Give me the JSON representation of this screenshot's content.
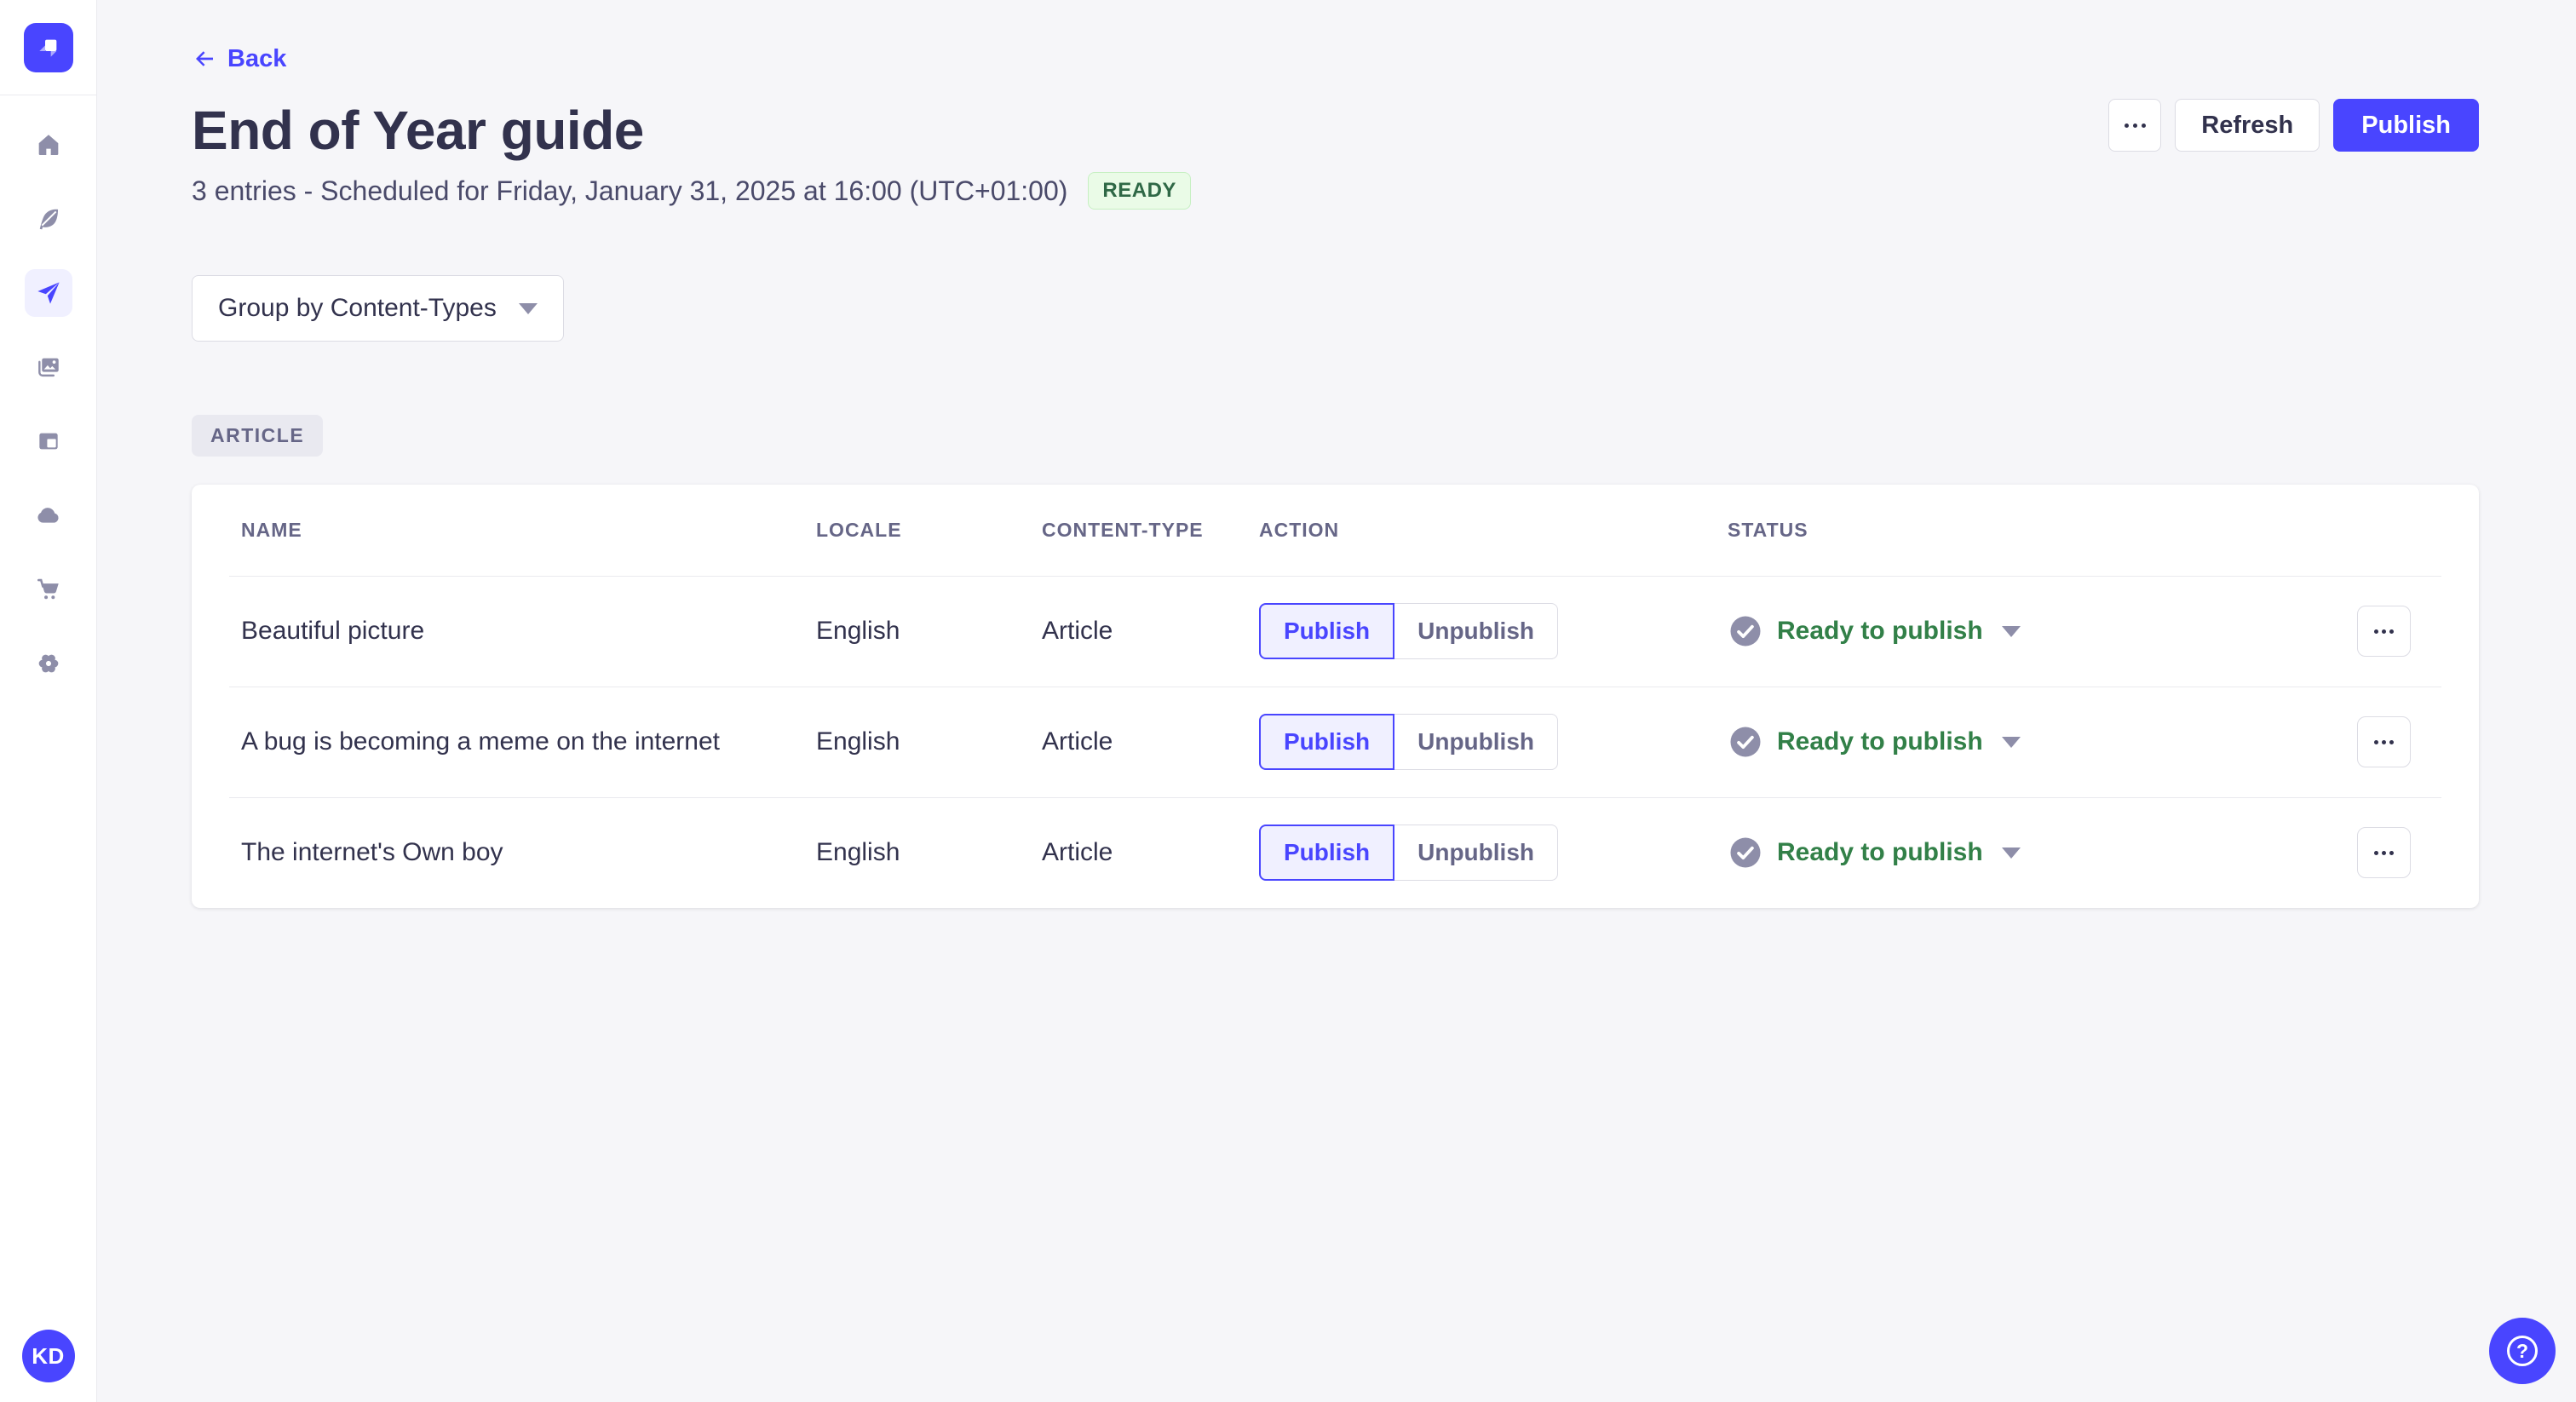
{
  "colors": {
    "primary": "#4945ff",
    "primary_light": "#f0f0ff",
    "success_badge_bg": "#eafbe7",
    "success_badge_border": "#c6f0c2",
    "success_badge_text": "#2f6846",
    "status_green": "#328048",
    "neutral_border": "#dcdce4",
    "divider": "#eaeaef",
    "page_bg": "#f6f6f9"
  },
  "sidebar": {
    "logo_icon": "strapi-logo",
    "nav_icons": [
      "home-icon",
      "feather-icon",
      "paper-plane-icon",
      "media-icon",
      "layout-icon",
      "cloud-icon",
      "cart-icon",
      "gear-icon"
    ],
    "active_item": "releases",
    "avatar_initials": "KD"
  },
  "header": {
    "back_label": "Back",
    "title": "End of Year guide",
    "subtitle": "3 entries - Scheduled for Friday, January 31, 2025 at 16:00 (UTC+01:00)",
    "status_badge": "READY",
    "refresh_label": "Refresh",
    "publish_label": "Publish",
    "more_icon": "ellipsis-icon"
  },
  "toolbar": {
    "group_by_label": "Group by Content-Types"
  },
  "group": {
    "badge_label": "ARTICLE"
  },
  "table": {
    "columns": [
      "NAME",
      "LOCALE",
      "CONTENT-TYPE",
      "ACTION",
      "STATUS"
    ],
    "actions": {
      "publish": "Publish",
      "unpublish": "Unpublish"
    },
    "rows": [
      {
        "name": "Beautiful picture",
        "locale": "English",
        "content_type": "Article",
        "status": "Ready to publish"
      },
      {
        "name": "A bug is becoming a meme on the internet",
        "locale": "English",
        "content_type": "Article",
        "status": "Ready to publish"
      },
      {
        "name": "The internet's Own boy",
        "locale": "English",
        "content_type": "Article",
        "status": "Ready to publish"
      }
    ]
  },
  "help": {
    "icon": "question-mark-icon"
  }
}
